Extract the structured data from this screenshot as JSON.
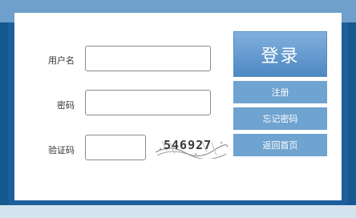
{
  "form": {
    "username_label": "用户名",
    "password_label": "密码",
    "captcha_label": "验证码",
    "username_value": "",
    "password_value": "",
    "captcha_value": "",
    "captcha_image_text": "546927"
  },
  "buttons": {
    "login": "登录",
    "register": "注册",
    "forgot_password": "忘记密码",
    "back_home": "返回首页"
  },
  "colors": {
    "frame_blue": "#1c5f9c",
    "top_bar": "#6f9fcb",
    "button_blue": "#6fa3d0"
  }
}
